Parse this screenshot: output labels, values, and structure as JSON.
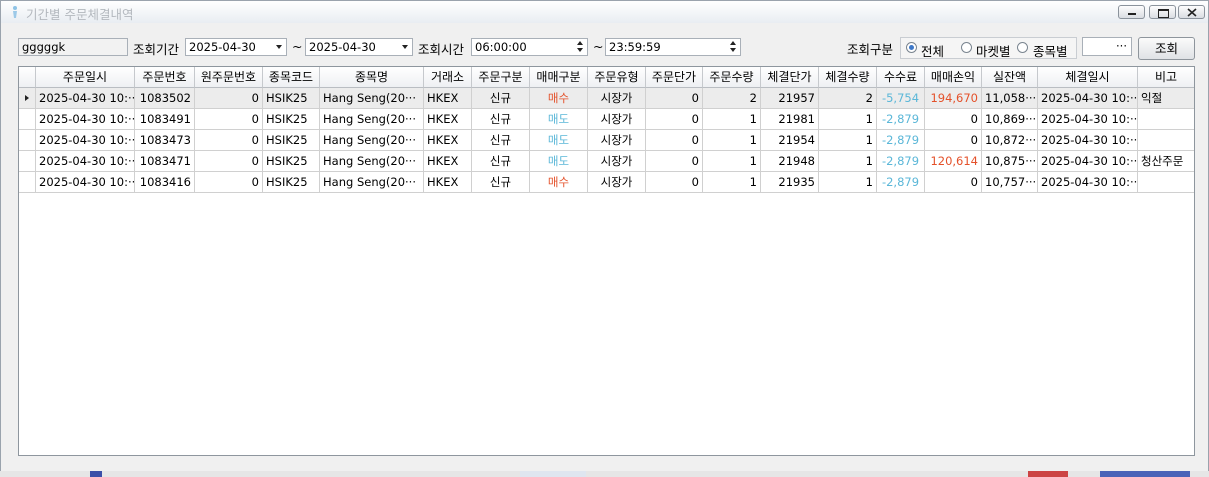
{
  "window": {
    "title": "기간별 주문체결내역",
    "controls": [
      "minimize-icon",
      "maximize-icon",
      "close-icon"
    ]
  },
  "filters": {
    "account": "gggggk",
    "period_label": "조회기간",
    "date_from": "2025-04-30",
    "range_sep": "~",
    "date_to": "2025-04-30",
    "time_label": "조회시간",
    "time_from": "06:00:00",
    "time_to": "23:59:59",
    "type_label": "조회구분",
    "options": [
      {
        "label": "전체",
        "selected": true
      },
      {
        "label": "마켓별",
        "selected": false
      },
      {
        "label": "종목별",
        "selected": false
      }
    ],
    "symbol_value": "···",
    "search_label": "조회"
  },
  "table": {
    "columns": [
      "주문일시",
      "주문번호",
      "원주문번호",
      "종목코드",
      "종목명",
      "거래소",
      "주문구분",
      "매매구분",
      "주문유형",
      "주문단가",
      "주문수량",
      "체결단가",
      "체결수량",
      "수수료",
      "매매손익",
      "실잔액",
      "체결일시",
      "비고"
    ],
    "rows": [
      [
        "2025-04-30 10:···",
        "1083502",
        "0",
        "HSIK25",
        "Hang Seng(20···",
        "HKEX",
        "신규",
        "매수",
        "시장가",
        "0",
        "2",
        "21957",
        "2",
        "-5,754",
        "194,670",
        "11,058···",
        "2025-04-30 10:···",
        "익절"
      ],
      [
        "2025-04-30 10:···",
        "1083491",
        "0",
        "HSIK25",
        "Hang Seng(20···",
        "HKEX",
        "신규",
        "매도",
        "시장가",
        "0",
        "1",
        "21981",
        "1",
        "-2,879",
        "0",
        "10,869···",
        "2025-04-30 10:···",
        ""
      ],
      [
        "2025-04-30 10:···",
        "1083473",
        "0",
        "HSIK25",
        "Hang Seng(20···",
        "HKEX",
        "신규",
        "매도",
        "시장가",
        "0",
        "1",
        "21954",
        "1",
        "-2,879",
        "0",
        "10,872···",
        "2025-04-30 10:···",
        ""
      ],
      [
        "2025-04-30 10:···",
        "1083471",
        "0",
        "HSIK25",
        "Hang Seng(20···",
        "HKEX",
        "신규",
        "매도",
        "시장가",
        "0",
        "1",
        "21948",
        "1",
        "-2,879",
        "120,614",
        "10,875···",
        "2025-04-30 10:···",
        "청산주문"
      ],
      [
        "2025-04-30 10:···",
        "1083416",
        "0",
        "HSIK25",
        "Hang Seng(20···",
        "HKEX",
        "신규",
        "매수",
        "시장가",
        "0",
        "1",
        "21935",
        "1",
        "-2,879",
        "0",
        "10,757···",
        "2025-04-30 10:···",
        ""
      ]
    ],
    "selected_row": 0
  },
  "colors": {
    "buy": "#e4512a",
    "sell": "#5bb7d8",
    "fee": "#5bb7d8",
    "profit": "#e4512a",
    "title_text": "#b3b8be",
    "radio_dot": "#3d78c8"
  }
}
